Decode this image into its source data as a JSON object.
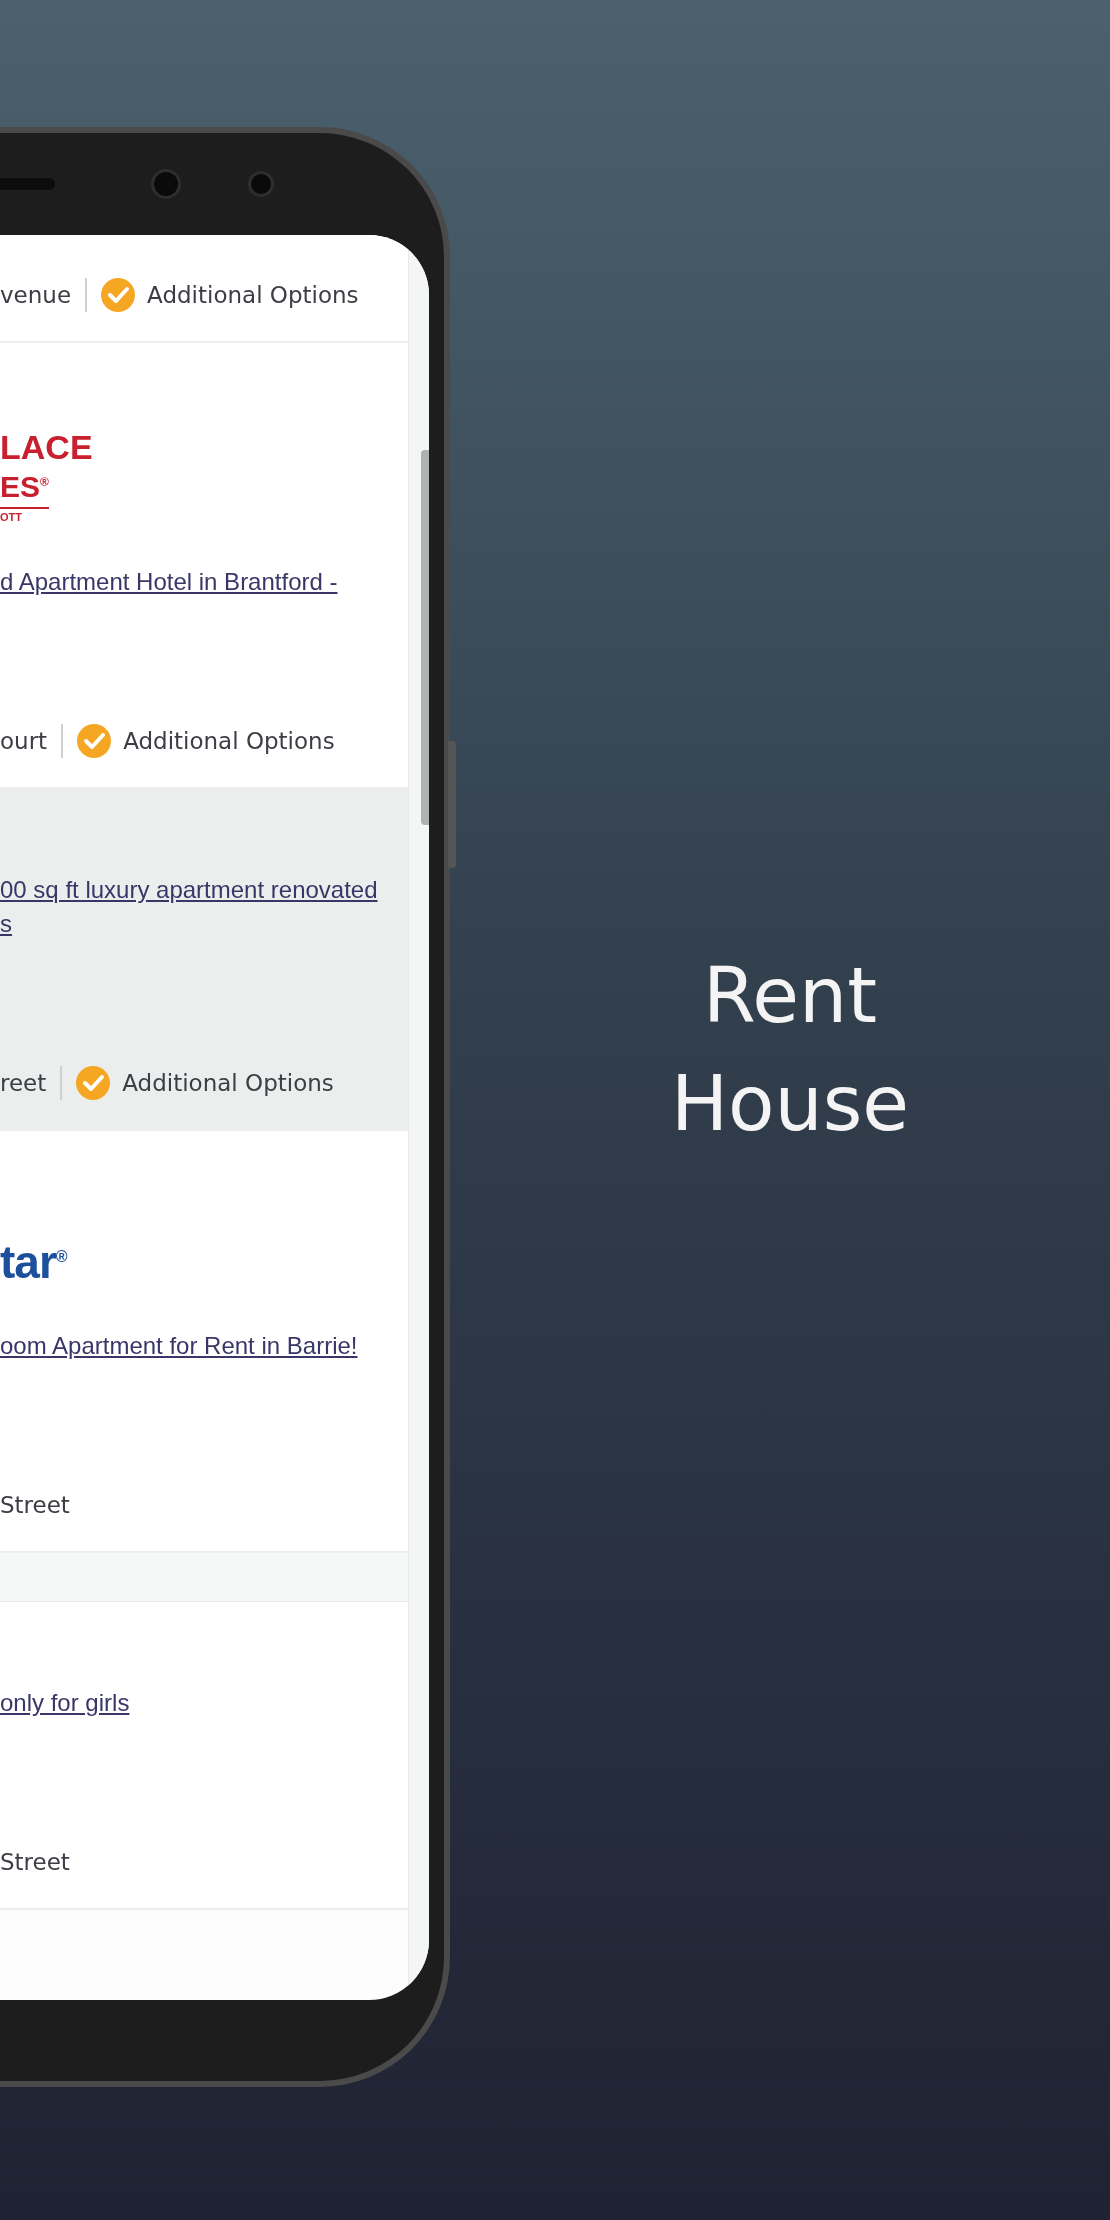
{
  "listings": [
    {
      "featured": false,
      "footer": {
        "address": "venue",
        "option": "Additional Options"
      }
    },
    {
      "featured": false,
      "logo": {
        "kind": "hotel",
        "lines": [
          "LACE",
          "ES$^{®}$",
          "OTT"
        ]
      },
      "title": [
        "d Apartment Hotel in Brantford -"
      ],
      "footer": {
        "address": "ourt",
        "option": "Additional Options"
      }
    },
    {
      "featured": true,
      "title": [
        "00 sq ft luxury apartment renovated",
        "s"
      ],
      "footer": {
        "address": "reet",
        "option": "Additional Options"
      }
    },
    {
      "featured": false,
      "logo": {
        "kind": "realty",
        "lines": [
          "tar$^{®}$"
        ]
      },
      "title": [
        "oom Apartment for Rent in Barrie!"
      ],
      "footer": {
        "address": "Street"
      }
    },
    {
      "featured": false,
      "title": [
        "only for girls"
      ],
      "footer": {
        "address": "Street"
      }
    }
  ],
  "headline": [
    "Rent",
    "House"
  ]
}
